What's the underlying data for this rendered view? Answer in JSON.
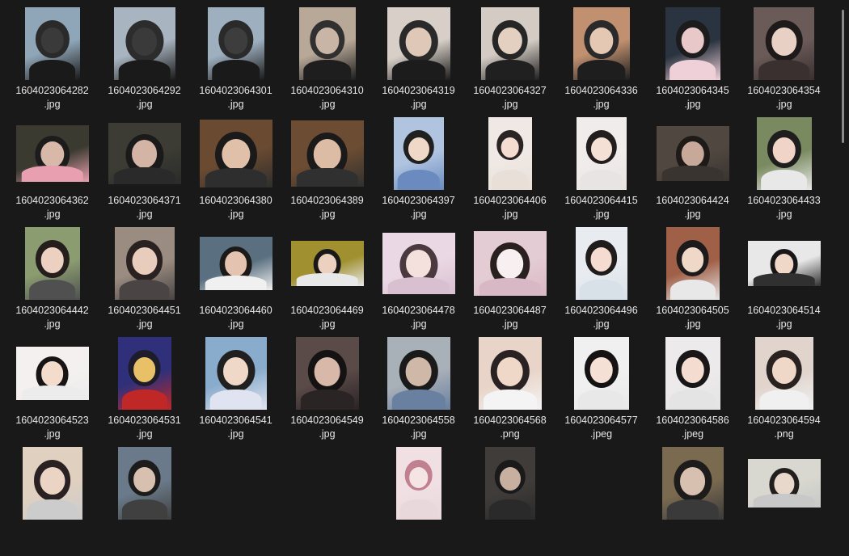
{
  "files": [
    {
      "name": "1604023064282",
      "ext": ".jpg",
      "w": 68,
      "h": 90,
      "colors": [
        "#8fa6b8",
        "#2a2a2a",
        "#3a3a3a",
        "#1a1a1a"
      ]
    },
    {
      "name": "1604023064292",
      "ext": ".jpg",
      "w": 76,
      "h": 90,
      "colors": [
        "#a8b4c0",
        "#2c2c2c",
        "#3a3a3a",
        "#1a1a1a"
      ]
    },
    {
      "name": "1604023064301",
      "ext": ".jpg",
      "w": 70,
      "h": 90,
      "colors": [
        "#9eb0c0",
        "#2a2a2a",
        "#3d3d3d",
        "#1a1a1a"
      ]
    },
    {
      "name": "1604023064310",
      "ext": ".jpg",
      "w": 70,
      "h": 90,
      "colors": [
        "#b8a898",
        "#303030",
        "#c9b5a5",
        "#1e1e1e"
      ]
    },
    {
      "name": "1604023064319",
      "ext": ".jpg",
      "w": 78,
      "h": 90,
      "colors": [
        "#d8d0c8",
        "#2a2a2a",
        "#e0c8b8",
        "#1c1c1c"
      ]
    },
    {
      "name": "1604023064327",
      "ext": ".jpg",
      "w": 72,
      "h": 90,
      "colors": [
        "#d4ccc4",
        "#262626",
        "#e4d0c0",
        "#202020"
      ]
    },
    {
      "name": "1604023064336",
      "ext": ".jpg",
      "w": 70,
      "h": 90,
      "colors": [
        "#c09070",
        "#2a2a2a",
        "#e4c8b4",
        "#1e1e1e"
      ]
    },
    {
      "name": "1604023064345",
      "ext": ".jpg",
      "w": 68,
      "h": 90,
      "colors": [
        "#2a3440",
        "#1c1c1c",
        "#e8c8c8",
        "#f0d0d8"
      ]
    },
    {
      "name": "1604023064354",
      "ext": ".jpg",
      "w": 75,
      "h": 90,
      "colors": [
        "#6a5a58",
        "#1e1a1a",
        "#e8d0c4",
        "#3a3030"
      ]
    },
    {
      "name": "1604023064362",
      "ext": ".jpg",
      "w": 90,
      "h": 70,
      "colors": [
        "#3a3a30",
        "#1c1c1c",
        "#d8b8a8",
        "#e8a0b0"
      ]
    },
    {
      "name": "1604023064371",
      "ext": ".jpg",
      "w": 90,
      "h": 76,
      "colors": [
        "#3c3c34",
        "#1a1a1a",
        "#d4b4a4",
        "#2a2a2a"
      ]
    },
    {
      "name": "1604023064380",
      "ext": ".jpg",
      "w": 90,
      "h": 84,
      "colors": [
        "#6a4a30",
        "#1a1a1a",
        "#e0c0a8",
        "#2e2e2e"
      ]
    },
    {
      "name": "1604023064389",
      "ext": ".jpg",
      "w": 90,
      "h": 82,
      "colors": [
        "#6c4c32",
        "#1a1a1a",
        "#dcbca4",
        "#303030"
      ]
    },
    {
      "name": "1604023064397",
      "ext": ".jpg",
      "w": 62,
      "h": 90,
      "colors": [
        "#b0c4e0",
        "#202020",
        "#f0d8c8",
        "#6a8ac0"
      ]
    },
    {
      "name": "1604023064406",
      "ext": ".jpg",
      "w": 54,
      "h": 90,
      "colors": [
        "#f0e8e4",
        "#2a2424",
        "#f4dcd0",
        "#e8e0d8"
      ]
    },
    {
      "name": "1604023064415",
      "ext": ".jpg",
      "w": 62,
      "h": 90,
      "colors": [
        "#f0ecec",
        "#221e1e",
        "#f4e0d4",
        "#e8e4e4"
      ]
    },
    {
      "name": "1604023064424",
      "ext": ".jpg",
      "w": 90,
      "h": 68,
      "colors": [
        "#504840",
        "#1e1a18",
        "#c8a898",
        "#3a3430"
      ]
    },
    {
      "name": "1604023064433",
      "ext": ".jpg",
      "w": 68,
      "h": 90,
      "colors": [
        "#7a8a60",
        "#1e1e1e",
        "#f0d4c8",
        "#e8e8e8"
      ]
    },
    {
      "name": "1604023064442",
      "ext": ".jpg",
      "w": 68,
      "h": 90,
      "colors": [
        "#8a9c70",
        "#241e1c",
        "#ecd0c0",
        "#505050"
      ]
    },
    {
      "name": "1604023064451",
      "ext": ".jpg",
      "w": 74,
      "h": 90,
      "colors": [
        "#9a8c80",
        "#2a2220",
        "#e8ccbc",
        "#4a4444"
      ]
    },
    {
      "name": "1604023064460",
      "ext": ".jpg",
      "w": 90,
      "h": 66,
      "colors": [
        "#5a7080",
        "#1c1a18",
        "#e4c4b0",
        "#f0f0f0"
      ]
    },
    {
      "name": "1604023064469",
      "ext": ".jpg",
      "w": 90,
      "h": 56,
      "colors": [
        "#a09030",
        "#1a1816",
        "#ecd0c0",
        "#e8e8e8"
      ]
    },
    {
      "name": "1604023064478",
      "ext": ".jpg",
      "w": 90,
      "h": 76,
      "colors": [
        "#ead8e4",
        "#4a3a40",
        "#f4e0dc",
        "#d8c0d0"
      ]
    },
    {
      "name": "1604023064487",
      "ext": ".jpg",
      "w": 90,
      "h": 80,
      "colors": [
        "#e4ccd4",
        "#2a2020",
        "#f8f0f0",
        "#d8b8c4"
      ]
    },
    {
      "name": "1604023064496",
      "ext": ".jpg",
      "w": 64,
      "h": 90,
      "colors": [
        "#e8ecf0",
        "#201c1c",
        "#f4dcd0",
        "#d8e0e8"
      ]
    },
    {
      "name": "1604023064505",
      "ext": ".jpg",
      "w": 66,
      "h": 90,
      "colors": [
        "#a06048",
        "#1c1a1a",
        "#f0d8c8",
        "#e8e8e8"
      ]
    },
    {
      "name": "1604023064514",
      "ext": ".jpg",
      "w": 90,
      "h": 56,
      "colors": [
        "#e8e8e8",
        "#181616",
        "#f0d8c8",
        "#303030"
      ]
    },
    {
      "name": "1604023064523",
      "ext": ".jpg",
      "w": 90,
      "h": 66,
      "colors": [
        "#f4f0f0",
        "#161414",
        "#f4dccc",
        "#ececec"
      ]
    },
    {
      "name": "1604023064531",
      "ext": ".jpg",
      "w": 66,
      "h": 90,
      "colors": [
        "#30307a",
        "#1c1c2a",
        "#e8c068",
        "#c02828"
      ]
    },
    {
      "name": "1604023064541",
      "ext": ".jpg",
      "w": 76,
      "h": 90,
      "colors": [
        "#8aaccc",
        "#202020",
        "#f0d8c8",
        "#e0e4f0"
      ]
    },
    {
      "name": "1604023064549",
      "ext": ".jpg",
      "w": 78,
      "h": 90,
      "colors": [
        "#5a4a48",
        "#141212",
        "#d8b8a8",
        "#2a2424"
      ]
    },
    {
      "name": "1604023064558",
      "ext": ".jpg",
      "w": 78,
      "h": 90,
      "colors": [
        "#a8b0b8",
        "#1a1a1a",
        "#d0b8a8",
        "#6a80a0"
      ]
    },
    {
      "name": "1604023064568",
      "ext": ".png",
      "w": 78,
      "h": 90,
      "colors": [
        "#e8d4c8",
        "#2a2222",
        "#f0d8c8",
        "#f4f4f4"
      ]
    },
    {
      "name": "1604023064577",
      "ext": ".jpeg",
      "w": 68,
      "h": 90,
      "colors": [
        "#f0f0f0",
        "#141212",
        "#f4e0d4",
        "#e8e8e8"
      ]
    },
    {
      "name": "1604023064586",
      "ext": ".jpeg",
      "w": 68,
      "h": 90,
      "colors": [
        "#eceaea",
        "#181616",
        "#f4dcd0",
        "#e4e4e4"
      ]
    },
    {
      "name": "1604023064594",
      "ext": ".png",
      "w": 72,
      "h": 90,
      "colors": [
        "#e0d4cc",
        "#2a2220",
        "#f0d8c8",
        "#f0f0f0"
      ]
    },
    {
      "name": "",
      "ext": "",
      "w": 74,
      "h": 90,
      "colors": [
        "#e0d0c0",
        "#2a2222",
        "#ecd4c4",
        "#cccccc"
      ]
    },
    {
      "name": "",
      "ext": "",
      "w": 66,
      "h": 90,
      "colors": [
        "#6a7a8a",
        "#1c1c1c",
        "#d8c0b0",
        "#404040"
      ]
    },
    {
      "name": "",
      "ext": "",
      "w": 0,
      "h": 0,
      "colors": [
        "#191919",
        "#191919",
        "#191919",
        "#191919"
      ]
    },
    {
      "name": "",
      "ext": "",
      "w": 0,
      "h": 0,
      "colors": [
        "#191919",
        "#191919",
        "#191919",
        "#191919"
      ]
    },
    {
      "name": "",
      "ext": "",
      "w": 56,
      "h": 90,
      "colors": [
        "#f0e0e4",
        "#c08090",
        "#f4e4e4",
        "#e8d8dc"
      ]
    },
    {
      "name": "",
      "ext": "",
      "w": 62,
      "h": 90,
      "colors": [
        "#403c3a",
        "#1a1a1a",
        "#c8b0a0",
        "#2a2a2a"
      ]
    },
    {
      "name": "",
      "ext": "",
      "w": 0,
      "h": 0,
      "colors": [
        "#191919",
        "#191919",
        "#191919",
        "#191919"
      ]
    },
    {
      "name": "",
      "ext": "",
      "w": 76,
      "h": 90,
      "colors": [
        "#7a6a50",
        "#1e1c1a",
        "#d8c0b0",
        "#3a3a3a"
      ]
    },
    {
      "name": "",
      "ext": "",
      "w": 90,
      "h": 60,
      "colors": [
        "#d8d8d0",
        "#201e1e",
        "#e8d8cc",
        "#c8c8c8"
      ]
    }
  ]
}
